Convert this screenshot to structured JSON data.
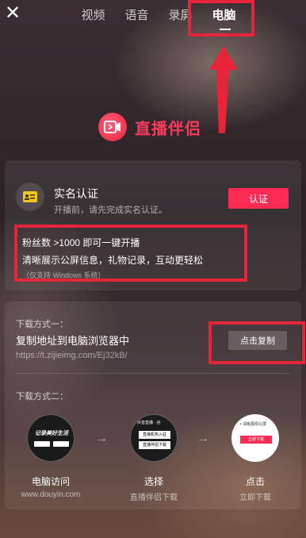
{
  "topbar": {
    "close_glyph": "✕",
    "tabs": [
      {
        "label": "视频"
      },
      {
        "label": "语音"
      },
      {
        "label": "录屏"
      },
      {
        "label": "电脑",
        "active": true
      }
    ]
  },
  "logo": {
    "title": "直播伴侣",
    "brand_color": "#ff3b5c"
  },
  "verify": {
    "title": "实名认证",
    "subtitle": "开播前，请先完成实名认证。",
    "button_label": "认证",
    "button_color": "#fe2c55"
  },
  "fans": {
    "line1": "粉丝数 >1000 即可一键开播",
    "line2": "清晰展示公屏信息，礼物记录，互动更轻松",
    "note": "（仅支持 Windows 系统）"
  },
  "download": {
    "method1_label": "下载方式一：",
    "method1_title": "复制地址到电脑浏览器中",
    "url": "https://t.zijieimg.com/Ej32kB/",
    "copy_button": "点击复制",
    "method2_label": "下载方式二：",
    "steps": [
      {
        "title": "电脑访问",
        "sub": "www.douyin.com",
        "thumb_text": "记录美好生活"
      },
      {
        "title": "选择",
        "sub": "直播伴侣下载",
        "thumb_top": "抖音直播 · 谷",
        "thumb_opt1": "直播机构入驻",
        "thumb_opt2": "直播伴侣下载"
      },
      {
        "title": "点击",
        "sub": "立即下载",
        "thumb_top": "• 清晰展现公屏",
        "thumb_btn": "立即下载"
      }
    ],
    "chevron": "→"
  },
  "annotation_color": "#e8243b"
}
